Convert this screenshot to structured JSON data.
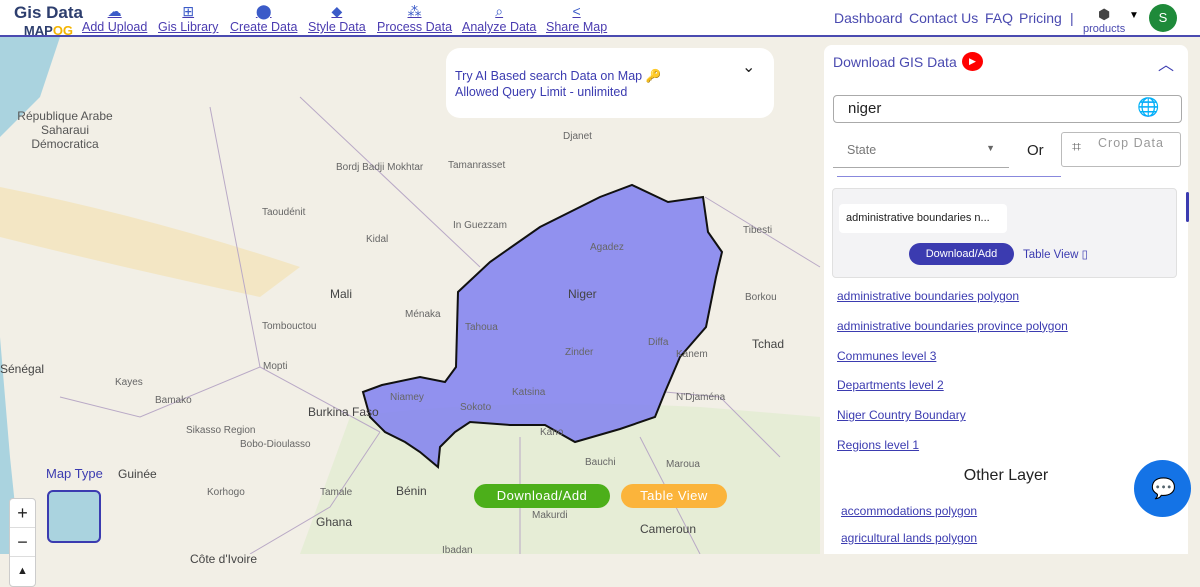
{
  "logo": {
    "line1": "Gis Data",
    "line2a": "MAP",
    "line2b": "OG"
  },
  "nav": [
    {
      "label": "Add Upload",
      "icon": "cloud-upload-icon",
      "glyph": "☁"
    },
    {
      "label": "Gis Library",
      "icon": "library-add-icon",
      "glyph": "⊞"
    },
    {
      "label": "Create Data",
      "icon": "location-pin-icon",
      "glyph": "⬤"
    },
    {
      "label": "Style Data",
      "icon": "paint-bucket-icon",
      "glyph": "◆"
    },
    {
      "label": "Process Data",
      "icon": "process-icon",
      "glyph": "⁂"
    },
    {
      "label": "Analyze Data",
      "icon": "analyze-icon",
      "glyph": "⌕"
    },
    {
      "label": "Share Map",
      "icon": "share-icon",
      "glyph": "<"
    }
  ],
  "right_nav": {
    "dashboard": "Dashboard",
    "contact": "Contact Us",
    "faq": "FAQ",
    "pricing": "Pricing",
    "separator": "|",
    "products": "products",
    "avatar": "S"
  },
  "ai_box": {
    "line1": "Try AI Based search Data on Map 🔑",
    "line2": "Allowed Query Limit - unlimited"
  },
  "panel": {
    "title": "Download GIS Data",
    "search_value": "niger",
    "state_placeholder": "State",
    "or": "Or",
    "crop": "Crop Data",
    "selected_layer": "administrative boundaries n...",
    "download_add": "Download/Add",
    "table_view": "Table View",
    "layers": [
      "administrative boundaries polygon",
      "administrative boundaries province polygon",
      "Communes level 3",
      "Departments level 2",
      "Niger Country Boundary",
      "Regions level 1"
    ],
    "other_title": "Other Layer",
    "other_layers": [
      "accommodations polygon",
      "agricultural lands polygon"
    ]
  },
  "map": {
    "download_add": "Download/Add",
    "table_view": "Table View",
    "map_type": "Map Type",
    "highlight_color": "#8080f0",
    "labels": [
      [
        "Niger",
        "big"
      ],
      [
        "Mali",
        "big"
      ],
      [
        "Agadez",
        ""
      ],
      [
        "Tahoua",
        ""
      ],
      [
        "Zinder",
        ""
      ],
      [
        "Diffa",
        ""
      ],
      [
        "Niamey",
        ""
      ],
      [
        "Sokoto",
        ""
      ],
      [
        "Kano",
        ""
      ],
      [
        "Katsina",
        ""
      ],
      [
        "Tchad",
        "big"
      ],
      [
        "Burkina Faso",
        "big"
      ],
      [
        "Bamako",
        ""
      ],
      [
        "Ménaka",
        ""
      ],
      [
        "Mopti",
        ""
      ],
      [
        "Tombouctou",
        ""
      ],
      [
        "Kidal",
        ""
      ],
      [
        "In Guezzam",
        ""
      ],
      [
        "Tamanrasset",
        ""
      ],
      [
        "Djanet",
        ""
      ],
      [
        "Taoudénit",
        ""
      ],
      [
        "Bordj Badji Mokhtar",
        ""
      ],
      [
        "Tibesti",
        ""
      ],
      [
        "Borkou",
        ""
      ],
      [
        "Kanem",
        ""
      ],
      [
        "N'Djaména",
        ""
      ],
      [
        "Bauchi",
        ""
      ],
      [
        "Maroua",
        ""
      ],
      [
        "Sénégal",
        "big"
      ],
      [
        "Guinée",
        "big"
      ],
      [
        "Bénin",
        "big"
      ],
      [
        "Ghana",
        "big"
      ],
      [
        "Korhogo",
        ""
      ],
      [
        "Tamale",
        ""
      ],
      [
        "Bobo-Dioulasso",
        ""
      ],
      [
        "Sikasso Region",
        ""
      ],
      [
        "Ibadan",
        ""
      ],
      [
        "Makurdi",
        ""
      ],
      [
        "Cameroun",
        "big"
      ],
      [
        "Côte d'Ivoire",
        "big"
      ],
      [
        "Kayes",
        ""
      ],
      [
        "République Arabe Saharaui Démocratica",
        ""
      ]
    ]
  },
  "zoom": {
    "in": "+",
    "out": "−",
    "reset": "▲"
  }
}
